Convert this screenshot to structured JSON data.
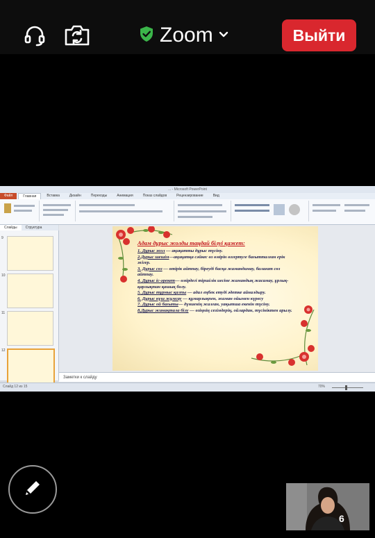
{
  "topbar": {
    "title": "Zoom",
    "exit_label": "Выйти",
    "headset_icon": "headset-icon",
    "camera_switch_icon": "camera-switch-icon",
    "shield_icon": "shield-check-icon",
    "chevron_icon": "chevron-down-icon"
  },
  "powerpoint": {
    "window_title": "... - Microsoft PowerPoint",
    "tabs": [
      "Файл",
      "Главная",
      "Вставка",
      "Дизайн",
      "Переходы",
      "Анимация",
      "Показ слайдов",
      "Рецензирование",
      "Вид"
    ],
    "side_tabs": [
      "Слайды",
      "Структура"
    ],
    "thumb_numbers": [
      "9",
      "10",
      "11",
      "12"
    ],
    "notes_placeholder": "Заметки к слайду",
    "status_left": "Слайд 12 из 15",
    "status_zoom": "70%"
  },
  "slide": {
    "heading": "Адам дұрыс жолды таңдай білуі қажет:",
    "items": [
      {
        "key": "1. Дұрыс жол",
        "rest": " — ақиқатты дұрыс түсіну."
      },
      {
        "key": "2.Дұрыс шешім",
        "rest": "—ақиқатқа сәйкес өз өмірін өзгертуге бағытталған ерік жігер."
      },
      {
        "key": "3. Дұрыс сөз",
        "rest": " — өтірік айтпау, біреуді басқа жамандамау, балағат сөз айтпау."
      },
      {
        "key": "4. Дұрыс іс-әрекет",
        "rest": "— өмірдегі тіршілік иесіне жамандық жасамау, ұрлық-қарлықтан қашық болу."
      },
      {
        "key": "5. Дұрыс тұрмыс қалпы",
        "rest": " — адал еңбек етуді әдетке айналдыру."
      },
      {
        "key": "6. Дұрыс күш жұмсау",
        "rest": " — құмарлықпен, жаман ойымен күресу"
      },
      {
        "key": "7. Дұрыс ой бағыты",
        "rest": "— дүниенің жалған, уақытша екенін түсіну."
      },
      {
        "key": "8.Дұрыс жинақтала білу",
        "rest": " — өзіңнің сезімдерің, ойлардан, түсініктен арылу."
      }
    ]
  },
  "colors": {
    "exit_bg": "#d9272e",
    "shield": "#3bb54a",
    "heading_red": "#c0121b",
    "slide_text": "#1c1c50"
  },
  "bottom": {
    "pen_icon": "pencil-icon"
  }
}
